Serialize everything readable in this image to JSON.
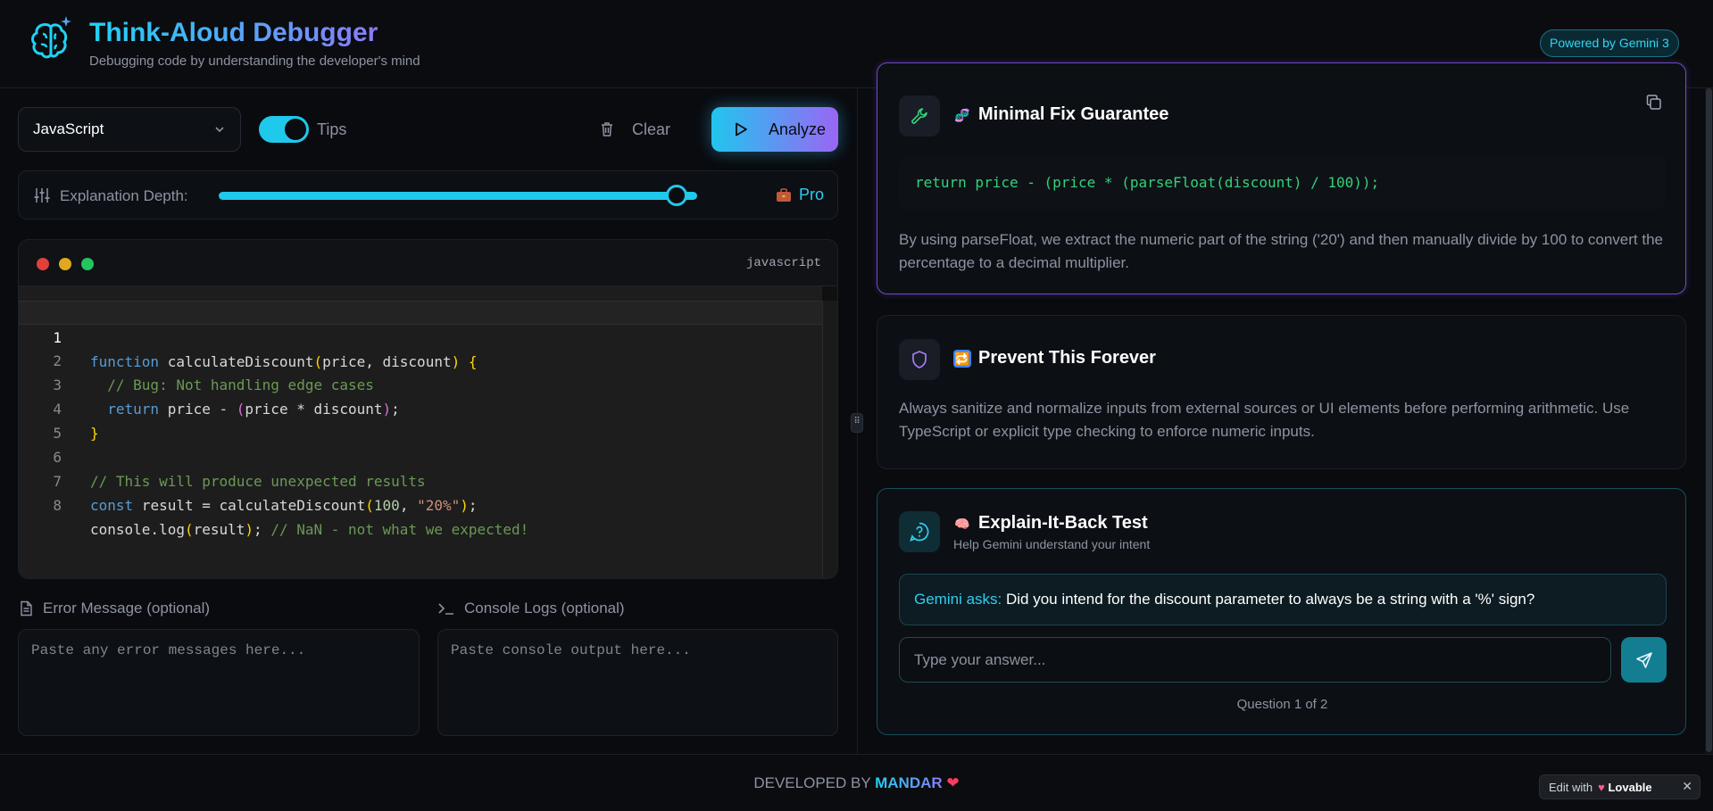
{
  "header": {
    "title": "Think-Aloud Debugger",
    "subtitle": "Debugging code by understanding the developer's mind",
    "badge": "Powered by Gemini 3"
  },
  "toolbar": {
    "language": "JavaScript",
    "tips_label": "Tips",
    "tips_enabled": true,
    "clear_label": "Clear",
    "analyze_label": "Analyze"
  },
  "depth": {
    "label": "Explanation Depth:",
    "level_label": "Pro",
    "level_fraction": 1.0
  },
  "editor": {
    "language_tag": "javascript",
    "line_numbers": [
      "1",
      "2",
      "3",
      "4",
      "5",
      "6",
      "7",
      "8"
    ]
  },
  "inputs": {
    "error_label": "Error Message (optional)",
    "error_placeholder": "Paste any error messages here...",
    "console_label": "Console Logs (optional)",
    "console_placeholder": "Paste console output here..."
  },
  "fix_card": {
    "title": "Minimal Fix Guarantee",
    "code": "return price - (price * (parseFloat(discount) / 100));",
    "description": "By using parseFloat, we extract the numeric part of the string ('20') and then manually divide by 100 to convert the percentage to a decimal multiplier."
  },
  "prevent_card": {
    "title": "Prevent This Forever",
    "description": "Always sanitize and normalize inputs from external sources or UI elements before performing arithmetic. Use TypeScript or explicit type checking to enforce numeric inputs."
  },
  "explain_card": {
    "title": "Explain-It-Back Test",
    "subtitle": "Help Gemini understand your intent",
    "question_lead": "Gemini asks:",
    "question": "Did you intend for the discount parameter to always be a string with a '%' sign?",
    "answer_placeholder": "Type your answer...",
    "counter": "Question 1 of 2"
  },
  "footer": {
    "developed_by": "DEVELOPED BY",
    "developer": "MANDAR",
    "lovable_prefix": "Edit with",
    "lovable_brand": "Lovable"
  },
  "colors": {
    "accent_cyan": "#1ec9ec",
    "accent_purple": "#9a66f5",
    "fix_code_green": "#33d17a"
  }
}
